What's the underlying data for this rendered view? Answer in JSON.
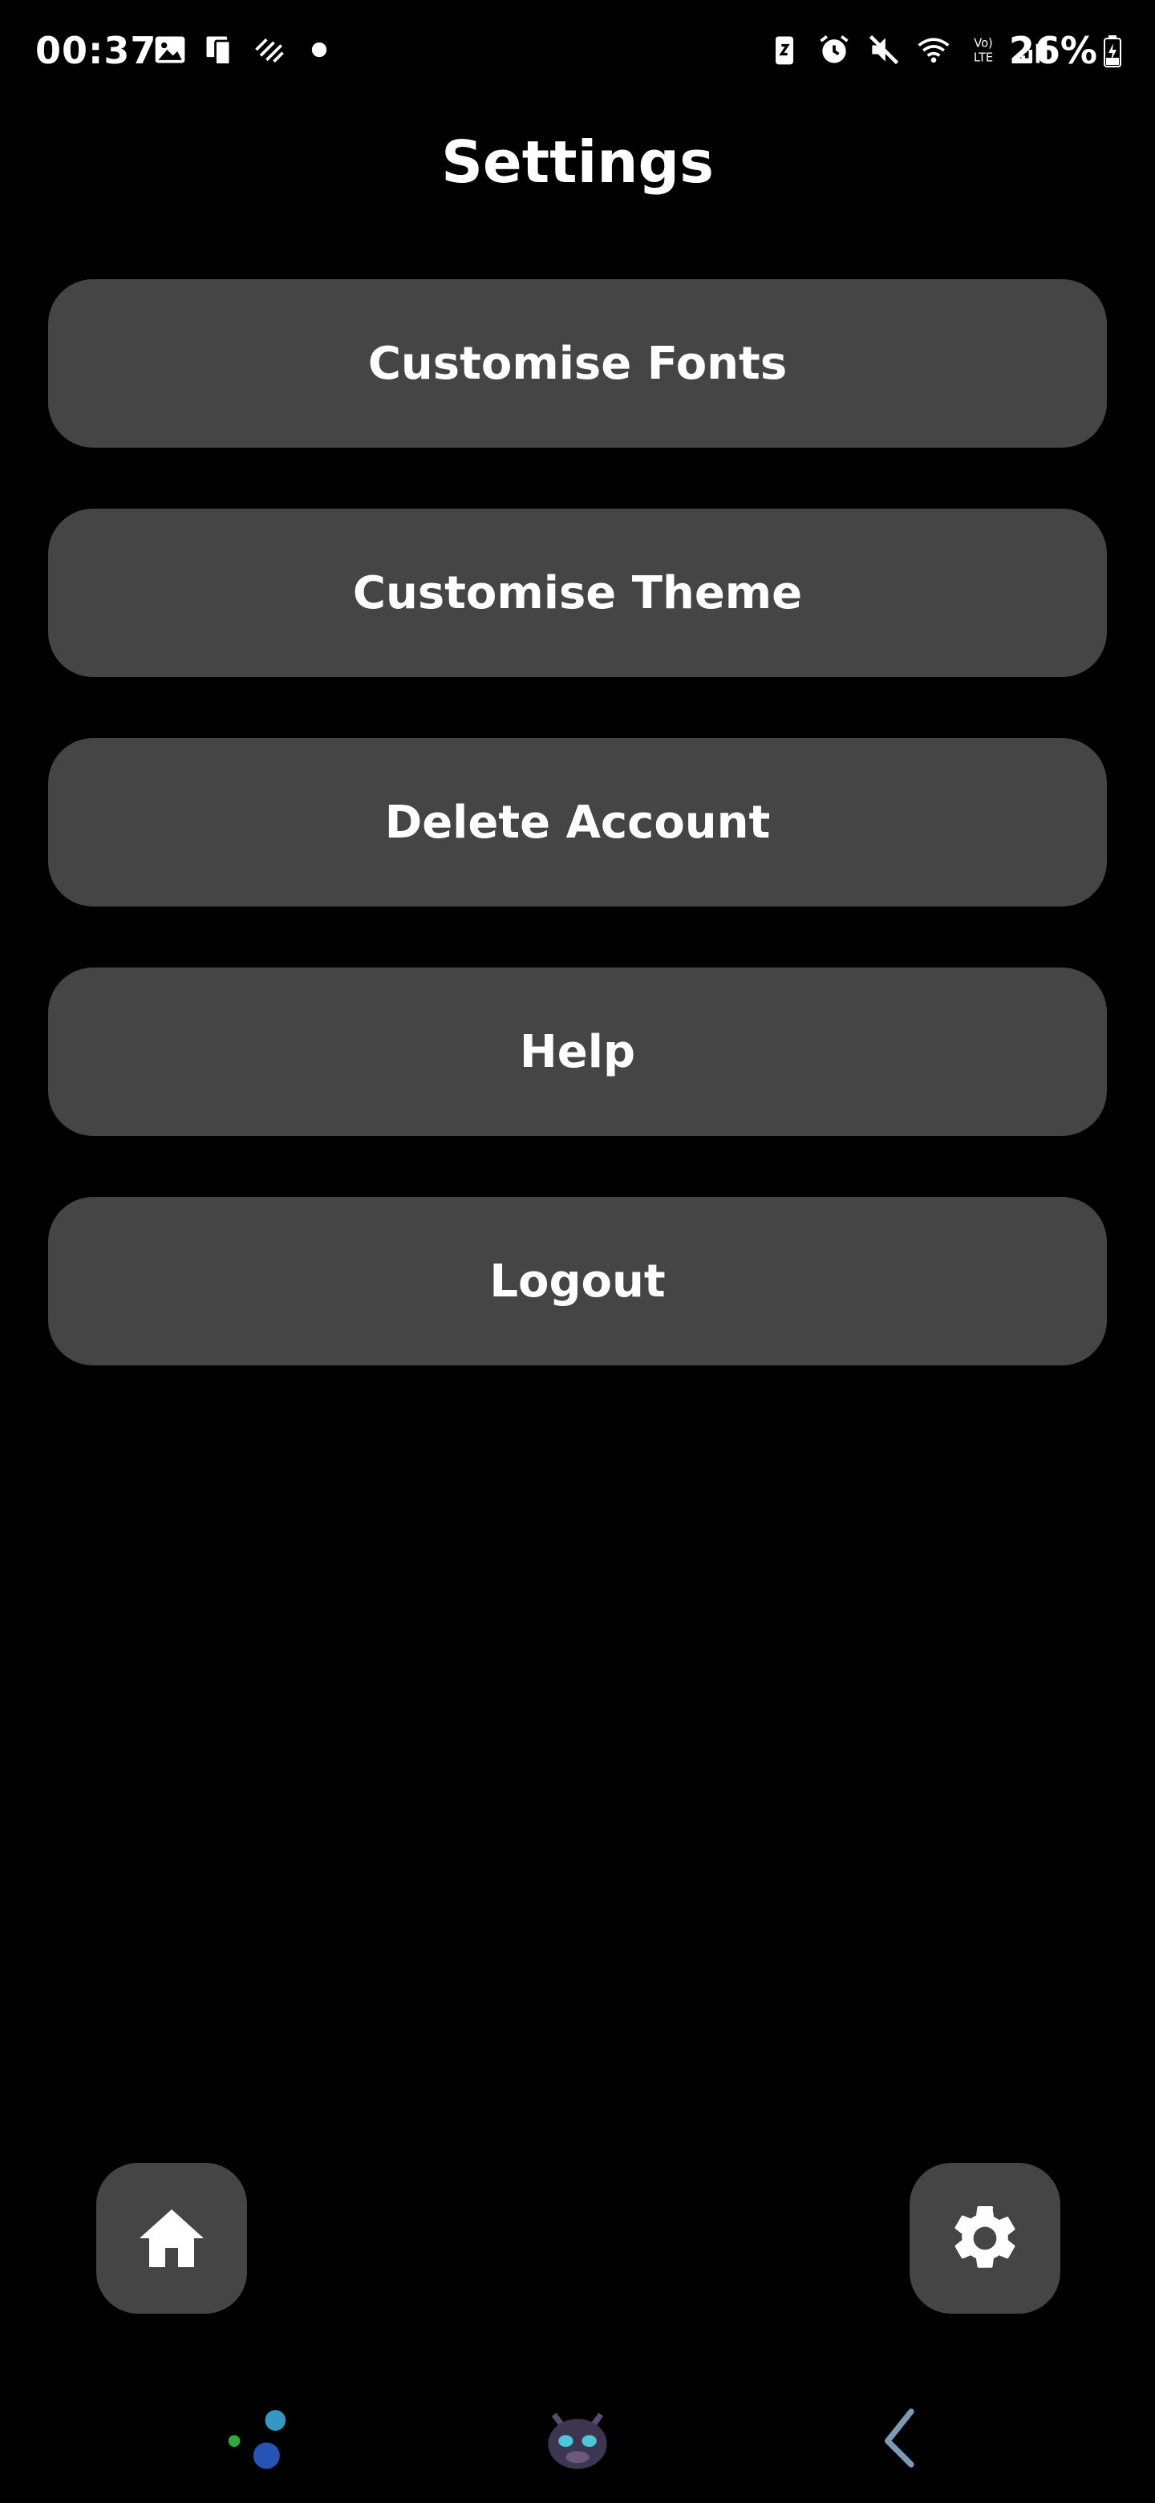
{
  "status_bar": {
    "time": "00:37",
    "battery": "26%",
    "left_icons": [
      "gallery-icon",
      "device-icon",
      "stripes-icon",
      "dot-icon"
    ],
    "right_icons": [
      "battery-saver-icon",
      "alarm-icon",
      "mute-icon",
      "wifi-icon",
      "volte-icon",
      "signal-icon"
    ]
  },
  "page": {
    "title": "Settings"
  },
  "settings": {
    "items": [
      {
        "label": "Customise Fonts"
      },
      {
        "label": "Customise Theme"
      },
      {
        "label": "Delete Account"
      },
      {
        "label": "Help"
      },
      {
        "label": "Logout"
      }
    ]
  },
  "fabs": {
    "home_icon": "home-icon",
    "settings_icon": "gear-icon"
  },
  "nav": {
    "items": [
      "dots-icon",
      "dragon-avatar-icon",
      "back-icon"
    ]
  },
  "colors": {
    "background": "#000000",
    "button": "#454545",
    "text": "#ffffff"
  }
}
